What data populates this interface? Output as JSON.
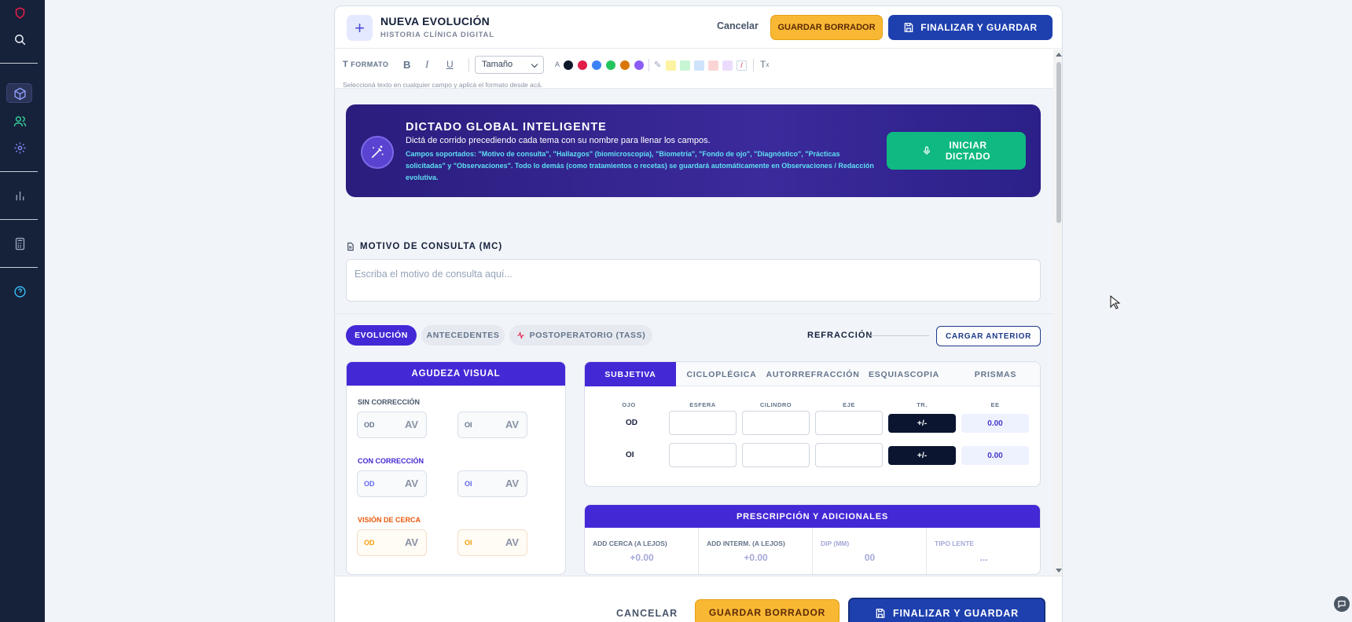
{
  "header": {
    "title": "NUEVA EVOLUCIÓN",
    "subtitle": "HISTORIA CLÍNICA DIGITAL",
    "cancel_label": "Cancelar",
    "draft_label": "GUARDAR BORRADOR",
    "finalize_label": "FINALIZAR Y GUARDAR"
  },
  "toolbar": {
    "format_label": "FORMATO",
    "size_label": "Tamaño",
    "font_color_label": "A",
    "hint": "Seleccioná texto en cualquier campo y aplicá el formato desde acá.",
    "text_colors": [
      "#0f172a",
      "#e11d48",
      "#3b82f6",
      "#22c55e",
      "#d97706",
      "#8b5cf6"
    ],
    "highlight_colors": [
      "#fef3a0",
      "#c8f5d4",
      "#cfe3fb",
      "#fbd5d5",
      "#ebdcfb"
    ]
  },
  "dictado": {
    "title": "DICTADO GLOBAL INTELIGENTE",
    "description": "Dictá de corrido precediendo cada tema con su nombre para llenar los campos.",
    "fields_text": "Campos soportados: \"Motivo de consulta\", \"Hallazgos\" (biomicroscopía), \"Biometría\", \"Fondo de ojo\", \"Diagnóstico\", \"Prácticas solicitadas\" y \"Observaciones\". Todo lo demás (como tratamientos o recetas) se guardará automáticamente en Observaciones / Redacción evolutiva.",
    "button_line1": "INICIAR",
    "button_line2": "DICTADO"
  },
  "motivo": {
    "label": "MOTIVO DE CONSULTA (MC)",
    "placeholder": "Escriba el motivo de consulta aquí..."
  },
  "tabs": {
    "evolucion": "EVOLUCIÓN",
    "antecedentes": "ANTECEDENTES",
    "postoperatorio": "POSTOPERATORIO (TASS)",
    "refraccion": "REFRACCIÓN",
    "cargar_anterior": "CARGAR ANTERIOR"
  },
  "agudeza": {
    "title": "AGUDEZA VISUAL",
    "sin_correccion": "SIN CORRECCIÓN",
    "con_correccion": "CON CORRECCIÓN",
    "vision_cerca": "VISIÓN DE CERCA",
    "od": "OD",
    "oi": "OI",
    "av": "AV"
  },
  "refraccion": {
    "tabs": [
      "SUBJETIVA",
      "CICLOPLÉGICA",
      "AUTORREFRACCIÓN",
      "ESQUIASCOPIA",
      "PRISMAS"
    ],
    "columns": [
      "OJO",
      "ESFERA",
      "CILINDRO",
      "EJE",
      "TR.",
      "EE"
    ],
    "rows": [
      {
        "eye": "OD",
        "tr": "+/-",
        "ee": "0.00"
      },
      {
        "eye": "OI",
        "tr": "+/-",
        "ee": "0.00"
      }
    ]
  },
  "prescripcion": {
    "title": "PRESCRIPCIÓN Y ADICIONALES",
    "cols": [
      {
        "label": "ADD CERCA (A LEJOS)",
        "value": "+0.00"
      },
      {
        "label": "ADD INTERM. (A LEJOS)",
        "value": "+0.00"
      },
      {
        "label": "DIP (MM)",
        "value": "00"
      },
      {
        "label": "TIPO LENTE",
        "value": "..."
      }
    ]
  },
  "footer": {
    "cancel_label": "CANCELAR",
    "draft_label": "GUARDAR BORRADOR",
    "finalize_label": "FINALIZAR Y GUARDAR"
  }
}
